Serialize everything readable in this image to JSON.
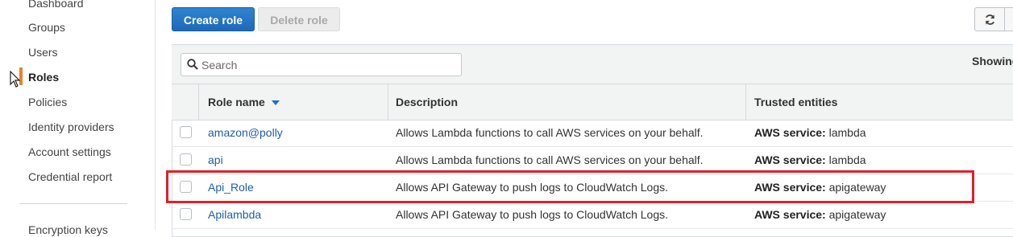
{
  "sidebar": {
    "items": [
      {
        "label": "Dashboard",
        "active": false
      },
      {
        "label": "Groups",
        "active": false
      },
      {
        "label": "Users",
        "active": false
      },
      {
        "label": "Roles",
        "active": true
      },
      {
        "label": "Policies",
        "active": false
      },
      {
        "label": "Identity providers",
        "active": false
      },
      {
        "label": "Account settings",
        "active": false
      },
      {
        "label": "Credential report",
        "active": false
      },
      {
        "label": "Encryption keys",
        "active": false
      }
    ],
    "active_color": "#e7832e"
  },
  "toolbar": {
    "create_label": "Create role",
    "delete_label": "Delete role",
    "refresh_icon": "refresh-icon"
  },
  "search": {
    "placeholder": "Search",
    "value": ""
  },
  "showing_label": "Showing",
  "table": {
    "columns": [
      "Role name",
      "Description",
      "Trusted entities"
    ],
    "sorted_column": "Role name",
    "rows": [
      {
        "name": "amazon@polly",
        "description": "Allows Lambda functions to call AWS services on your behalf.",
        "trusted_prefix": "AWS service:",
        "trusted_value": "lambda"
      },
      {
        "name": "api",
        "description": "Allows Lambda functions to call AWS services on your behalf.",
        "trusted_prefix": "AWS service:",
        "trusted_value": "lambda"
      },
      {
        "name": "Api_Role",
        "description": "Allows API Gateway to push logs to CloudWatch Logs.",
        "trusted_prefix": "AWS service:",
        "trusted_value": "apigateway"
      },
      {
        "name": "Apilambda",
        "description": "Allows API Gateway to push logs to CloudWatch Logs.",
        "trusted_prefix": "AWS service:",
        "trusted_value": "apigateway"
      }
    ]
  },
  "colors": {
    "primary": "#1d69b8",
    "link": "#1f5fa8",
    "highlight": "#e0202a"
  }
}
